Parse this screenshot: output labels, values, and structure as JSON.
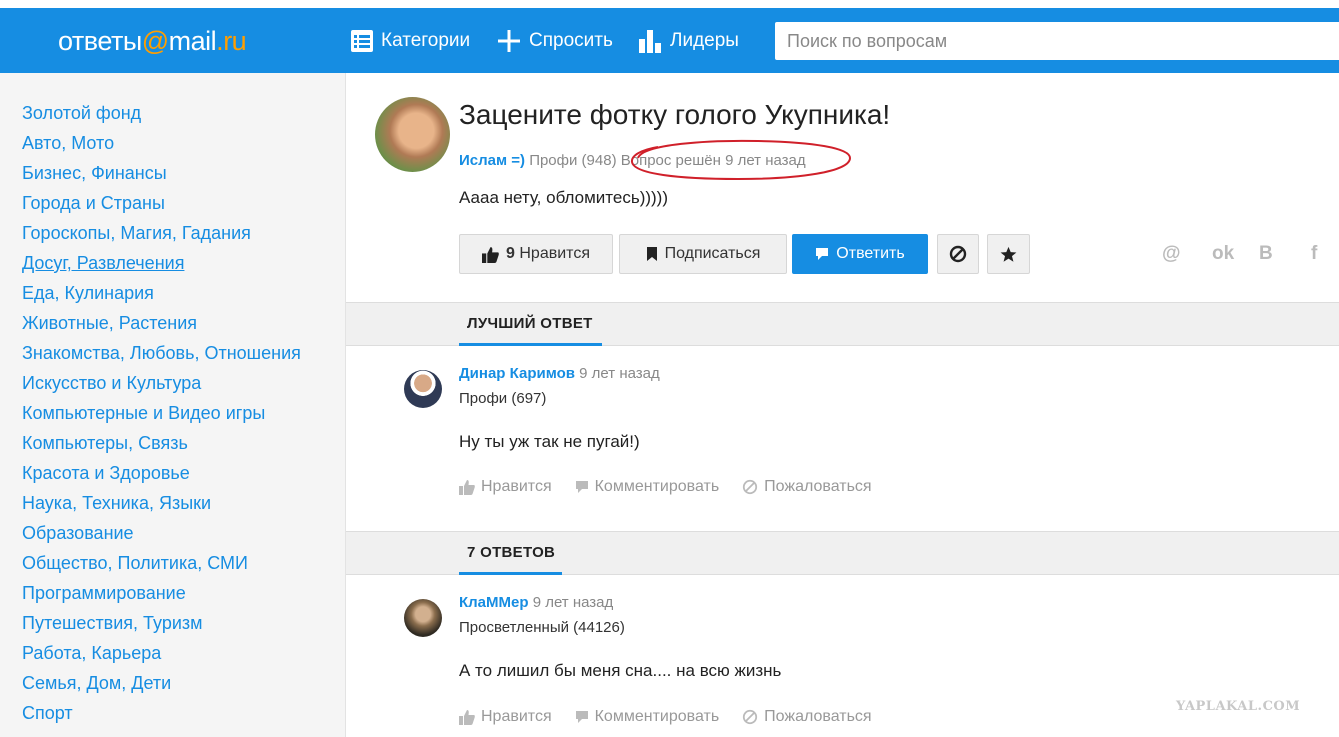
{
  "header": {
    "logo": {
      "part1": "ответы",
      "at": "@",
      "part2": "mail",
      "dot": ".",
      "ru": "ru"
    },
    "nav": [
      {
        "label": "Категории",
        "icon": "list-icon"
      },
      {
        "label": "Спросить",
        "icon": "plus-icon"
      },
      {
        "label": "Лидеры",
        "icon": "bar-chart-icon"
      }
    ],
    "search_placeholder": "Поиск по вопросам"
  },
  "sidebar": {
    "items": [
      {
        "label": "Золотой фонд"
      },
      {
        "label": "Авто, Мото"
      },
      {
        "label": "Бизнес, Финансы"
      },
      {
        "label": "Города и Страны"
      },
      {
        "label": "Гороскопы, Магия, Гадания"
      },
      {
        "label": "Досуг, Развлечения"
      },
      {
        "label": "Еда, Кулинария"
      },
      {
        "label": "Животные, Растения"
      },
      {
        "label": "Знакомства, Любовь, Отношения"
      },
      {
        "label": "Искусство и Культура"
      },
      {
        "label": "Компьютерные и Видео игры"
      },
      {
        "label": "Компьютеры, Связь"
      },
      {
        "label": "Красота и Здоровье"
      },
      {
        "label": "Наука, Техника, Языки"
      },
      {
        "label": "Образование"
      },
      {
        "label": "Общество, Политика, СМИ"
      },
      {
        "label": "Программирование"
      },
      {
        "label": "Путешествия, Туризм"
      },
      {
        "label": "Работа, Карьера"
      },
      {
        "label": "Семья, Дом, Дети"
      },
      {
        "label": "Спорт"
      }
    ],
    "active_index": 5
  },
  "question": {
    "title": "Зацените фотку голого Укупника!",
    "author": "Ислам =)",
    "rank": "Профи (948)",
    "status": "Вопрос решён 9 лет назад",
    "text": "Аааа нету, обломитесь)))))",
    "buttons": {
      "like_count": "9",
      "like_label": "Нравится",
      "subscribe": "Подписаться",
      "answer": "Ответить"
    },
    "social": [
      "@",
      "ok",
      "B",
      "f"
    ]
  },
  "best_answer": {
    "section_label": "ЛУЧШИЙ ОТВЕТ",
    "author": "Динар Каримов",
    "time": "9 лет назад",
    "rank": "Профи (697)",
    "text": "Ну ты уж так не пугай!)"
  },
  "answers": {
    "section_label": "7 ОТВЕТОВ",
    "items": [
      {
        "author": "КлаММер",
        "time": "9 лет назад",
        "rank": "Просветленный (44126)",
        "text": "А то лишил бы меня сна.... на всю жизнь"
      }
    ]
  },
  "actions": {
    "like": "Нравится",
    "comment": "Комментировать",
    "report": "Пожаловаться"
  },
  "watermark": "YAPLAKAL.COM",
  "colors": {
    "brand": "#168de2",
    "logo_accent": "#ff9e00",
    "annotation": "#d0202a"
  }
}
